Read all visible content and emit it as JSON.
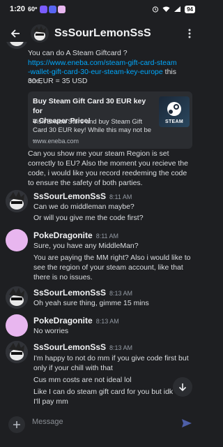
{
  "status": {
    "time": "1:20",
    "network_speed": "60º",
    "battery": "94"
  },
  "header": {
    "title": "SsSourLemonSsS"
  },
  "messages": [
    {
      "lines": [
        "You can do A Steam Giftcard ?"
      ],
      "link": "https://www.eneba.com/steam-gift-card-steam-wallet-gift-card-30-eur-steam-key-europe",
      "link_line1": "https://www.eneba.com/steam-gift-card-steam",
      "link_line2": "-wallet-gift-card-30-eur-steam-key-europe",
      "after_link": " this one,",
      "line3": "30 EUR = 35 USD",
      "embed": {
        "title_l1": "Buy Steam Gift Card 30 EUR key for",
        "title_l2": "a Cheaper Price!",
        "desc_l1": "Visit Eneba Store and buy Steam Gift",
        "desc_l2": "Card 30 EUR key! While this may not be ...",
        "site": "www.eneba.com",
        "thumb_text": "STEAM"
      },
      "extra_l1": "Can you show me your steam Region is set",
      "extra_l2": "correctly to EU? Also the moment you recieve the",
      "extra_l3": "code, i would like you record reedeming the code",
      "extra_l4": "to ensure the safety of both parties."
    },
    {
      "author": "SsSourLemonSsS",
      "time": "8:11 AM",
      "l1": "Can we do middleman maybe?",
      "l2": "Or will you give me the code first?"
    },
    {
      "author": "PokeDragonite",
      "time": "8:11 AM",
      "l1": "Sure, you have any MiddleMan?",
      "l2": "You are paying the MM right? Also i would like to",
      "l3": "see the region of your steam account, like that",
      "l4": "there is no issues."
    },
    {
      "author": "SsSourLemonSsS",
      "time": "8:13 AM",
      "l1": "Oh yeah sure thing, gimme 15 mins"
    },
    {
      "author": "PokeDragonite",
      "time": "8:13 AM",
      "l1": "No worries"
    },
    {
      "author": "SsSourLemonSsS",
      "time": "8:13 AM",
      "l1": "I'm happy to not do mm if you give code first but",
      "l2": "only if your chill with that",
      "l3": "Cus mm costs are not ideal lol",
      "l4": "Like I can do steam gift card for you but idk",
      "l5": "I'll pay mm"
    }
  ],
  "composer": {
    "placeholder": "Message"
  },
  "colors": {
    "background": "#1e1f22",
    "link": "#00a8fc",
    "accent": "#5865f2",
    "poke_avatar": "#e8b6ef"
  }
}
